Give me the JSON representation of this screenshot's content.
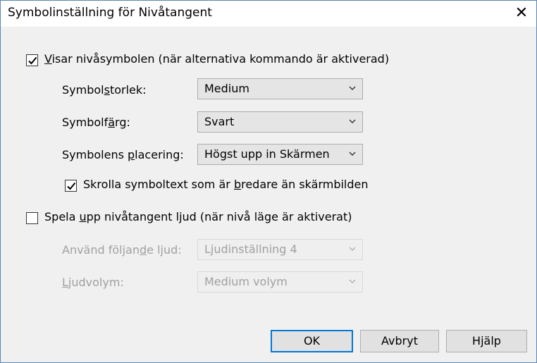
{
  "window": {
    "title": "Symbolinställning för Nivåtangent",
    "close_glyph": "✕"
  },
  "show_symbol": {
    "checked": true,
    "label_prefix": "",
    "label_ul": "V",
    "label_suffix": "isar nivåsymbolen (när alternativa kommando är aktiverad)"
  },
  "symbol_size": {
    "label_prefix": "Symbol",
    "label_ul": "s",
    "label_suffix": "torlek:",
    "value": "Medium"
  },
  "symbol_color": {
    "label_prefix": "Symbolf",
    "label_ul": "ä",
    "label_suffix": "rg:",
    "value": "Svart"
  },
  "symbol_position": {
    "label_prefix": "Symbolens ",
    "label_ul": "p",
    "label_suffix": "lacering:",
    "value": "Högst upp in Skärmen"
  },
  "scroll_text": {
    "checked": true,
    "label_prefix": "Skrolla symboltext som är ",
    "label_ul": "b",
    "label_suffix": "redare än skärmbilden"
  },
  "play_sound": {
    "checked": false,
    "label_prefix": "Spela ",
    "label_ul": "u",
    "label_suffix": "pp nivåtangent ljud (när nivå läge är aktiverat)"
  },
  "sound_setting": {
    "label_prefix": "Använd följan",
    "label_ul": "d",
    "label_suffix": "e ljud:",
    "value": "Ljudinställning 4"
  },
  "volume": {
    "label_prefix": "",
    "label_ul": "L",
    "label_suffix": "judvolym:",
    "value": "Medium volym"
  },
  "buttons": {
    "ok": "OK",
    "cancel": "Avbryt",
    "help": "Hjälp"
  }
}
